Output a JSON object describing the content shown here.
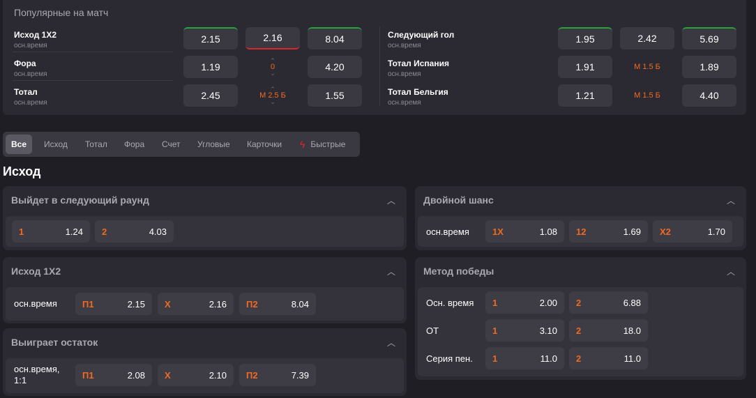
{
  "popular": {
    "title": "Популярные на матч",
    "left": [
      {
        "name": "Исход 1Х2",
        "sub": "осн.время",
        "o1": "2.15",
        "o2": "2.16",
        "o3": "8.04"
      },
      {
        "name": "Фора",
        "sub": "осн.время",
        "o1": "1.19",
        "mid": "0",
        "o3": "4.20"
      },
      {
        "name": "Тотал",
        "sub": "осн.время",
        "o1": "2.45",
        "mid": "М 2.5 Б",
        "o3": "1.55"
      }
    ],
    "right": [
      {
        "name": "Следующий гол",
        "sub": "осн.время",
        "o1": "1.95",
        "o2": "2.42",
        "o3": "5.69"
      },
      {
        "name": "Тотал Испания",
        "sub": "осн.время",
        "o1": "1.91",
        "mid": "М 1.5 Б",
        "o3": "1.89"
      },
      {
        "name": "Тотал Бельгия",
        "sub": "осн.время",
        "o1": "1.21",
        "mid": "М 1.5 Б",
        "o3": "4.40"
      }
    ]
  },
  "tabs": [
    "Все",
    "Исход",
    "Тотал",
    "Фора",
    "Счет",
    "Угловые",
    "Карточки",
    "Быстрые"
  ],
  "section_title": "Исход",
  "cards": {
    "next_round": {
      "title": "Выйдет в следующий раунд",
      "items": [
        {
          "k": "1",
          "v": "1.24"
        },
        {
          "k": "2",
          "v": "4.03"
        }
      ]
    },
    "outcome": {
      "title": "Исход 1Х2",
      "label": "осн.время",
      "items": [
        {
          "k": "П1",
          "v": "2.15"
        },
        {
          "k": "Х",
          "v": "2.16"
        },
        {
          "k": "П2",
          "v": "8.04"
        }
      ]
    },
    "remainder": {
      "title": "Выиграет остаток",
      "label": "осн.время, 1:1",
      "items": [
        {
          "k": "П1",
          "v": "2.08"
        },
        {
          "k": "Х",
          "v": "2.10"
        },
        {
          "k": "П2",
          "v": "7.39"
        }
      ]
    },
    "double": {
      "title": "Двойной шанс",
      "label": "осн.время",
      "items": [
        {
          "k": "1Х",
          "v": "1.08"
        },
        {
          "k": "12",
          "v": "1.69"
        },
        {
          "k": "Х2",
          "v": "1.70"
        }
      ]
    },
    "method": {
      "title": "Метод победы",
      "rows": [
        {
          "label": "Осн. время",
          "items": [
            {
              "k": "1",
              "v": "2.00"
            },
            {
              "k": "2",
              "v": "6.88"
            }
          ]
        },
        {
          "label": "ОТ",
          "items": [
            {
              "k": "1",
              "v": "3.10"
            },
            {
              "k": "2",
              "v": "18.0"
            }
          ]
        },
        {
          "label": "Серия пен.",
          "items": [
            {
              "k": "1",
              "v": "11.0"
            },
            {
              "k": "2",
              "v": "11.0"
            }
          ]
        }
      ]
    }
  },
  "icons": {
    "collapse": "chevron-up-icon",
    "fast": "lightning-icon",
    "arrow_up": "chevron-up-icon",
    "arrow_down": "chevron-down-icon"
  },
  "colors": {
    "accent": "#f26a21",
    "up": "#29a33b",
    "down": "#d8262d"
  }
}
